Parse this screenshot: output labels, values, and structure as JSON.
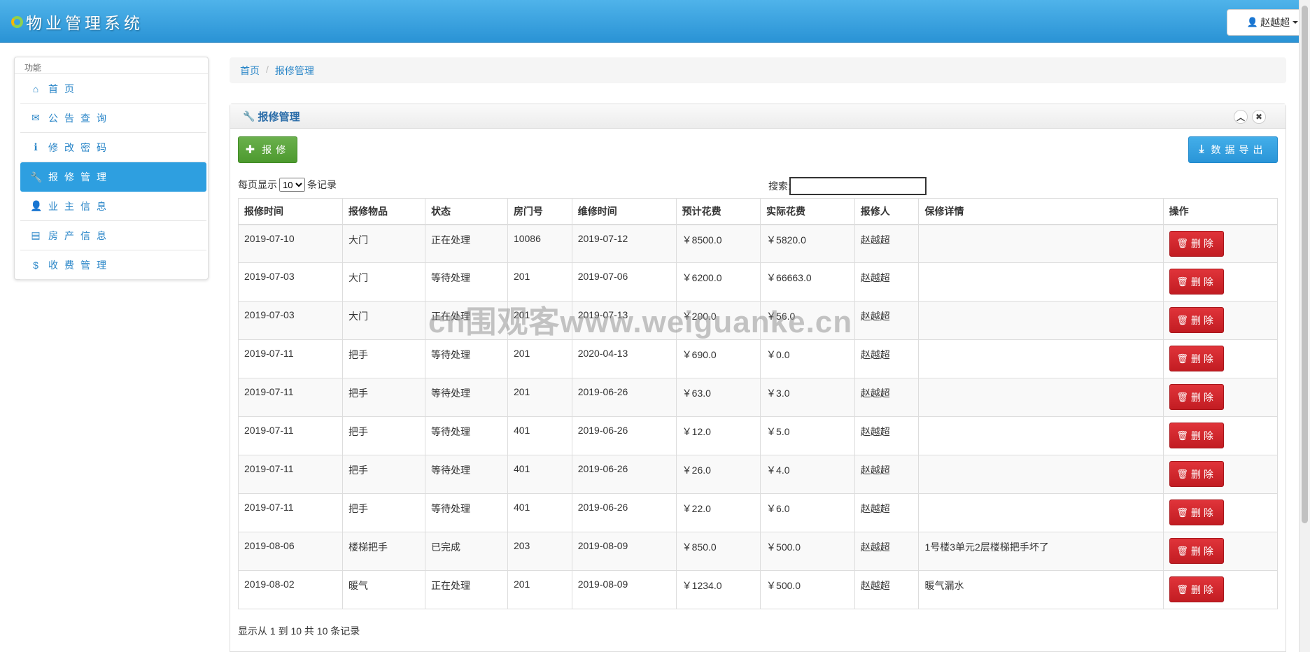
{
  "app": {
    "title": "物业管理系统",
    "user_name": "赵越超"
  },
  "sidebar": {
    "heading": "功能",
    "items": [
      {
        "label": "首页",
        "icon": "home-icon",
        "glyph": "⌂"
      },
      {
        "label": "公告查询",
        "icon": "envelope-icon",
        "glyph": "✉"
      },
      {
        "label": "修改密码",
        "icon": "info-icon",
        "glyph": "ℹ"
      },
      {
        "label": "报修管理",
        "icon": "wrench-icon",
        "glyph": "🔧"
      },
      {
        "label": "业主信息",
        "icon": "user-icon",
        "glyph": "👤"
      },
      {
        "label": "房产信息",
        "icon": "list-icon",
        "glyph": "▤"
      },
      {
        "label": "收费管理",
        "icon": "dollar-icon",
        "glyph": "$"
      }
    ]
  },
  "breadcrumb": {
    "home": "首页",
    "current": "报修管理"
  },
  "panel": {
    "title": "报修管理",
    "add_label": "报修",
    "export_label": "数据导出",
    "length_prefix": "每页显示",
    "length_value": "10",
    "length_suffix": "条记录",
    "search_label": "搜索:",
    "search_value": "",
    "info": "显示从 1 到 10 共 10 条记录",
    "delete_label": "删除"
  },
  "table": {
    "columns": [
      "报修时间",
      "报修物品",
      "状态",
      "房门号",
      "维修时间",
      "预计花费",
      "实际花费",
      "报修人",
      "保修详情",
      "操作"
    ],
    "rows": [
      [
        "2019-07-10",
        "大门",
        "正在处理",
        "10086",
        "2019-07-12",
        "￥8500.0",
        "￥5820.0",
        "赵越超",
        ""
      ],
      [
        "2019-07-03",
        "大门",
        "等待处理",
        "201",
        "2019-07-06",
        "￥6200.0",
        "￥66663.0",
        "赵越超",
        ""
      ],
      [
        "2019-07-03",
        "大门",
        "正在处理",
        "201",
        "2019-07-13",
        "￥200.0",
        "￥56.0",
        "赵越超",
        ""
      ],
      [
        "2019-07-11",
        "把手",
        "等待处理",
        "201",
        "2020-04-13",
        "￥690.0",
        "￥0.0",
        "赵越超",
        ""
      ],
      [
        "2019-07-11",
        "把手",
        "等待处理",
        "201",
        "2019-06-26",
        "￥63.0",
        "￥3.0",
        "赵越超",
        ""
      ],
      [
        "2019-07-11",
        "把手",
        "等待处理",
        "401",
        "2019-06-26",
        "￥12.0",
        "￥5.0",
        "赵越超",
        ""
      ],
      [
        "2019-07-11",
        "把手",
        "等待处理",
        "401",
        "2019-06-26",
        "￥26.0",
        "￥4.0",
        "赵越超",
        ""
      ],
      [
        "2019-07-11",
        "把手",
        "等待处理",
        "401",
        "2019-06-26",
        "￥22.0",
        "￥6.0",
        "赵越超",
        ""
      ],
      [
        "2019-08-06",
        "楼梯把手",
        "已完成",
        "203",
        "2019-08-09",
        "￥850.0",
        "￥500.0",
        "赵越超",
        "1号楼3单元2层楼梯把手坏了"
      ],
      [
        "2019-08-02",
        "暖气",
        "正在处理",
        "201",
        "2019-08-09",
        "￥1234.0",
        "￥500.0",
        "赵越超",
        "暖气漏水"
      ]
    ]
  },
  "watermark": "cn围观客www.weiguanke.cn"
}
